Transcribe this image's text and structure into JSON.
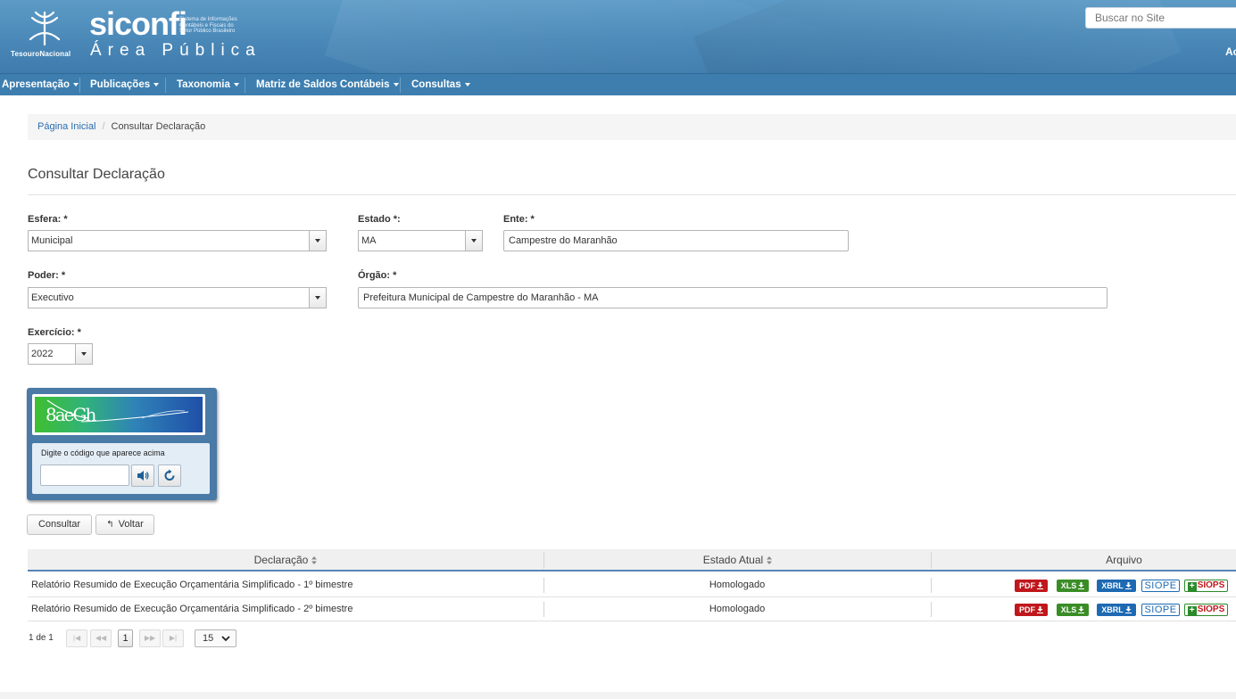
{
  "header": {
    "brand_left": "TesouroNacional",
    "brand": "siconfi",
    "brand_subtitle_1": "Sistema de Informações",
    "brand_subtitle_2": "Contábeis e Fiscais do",
    "brand_subtitle_3": "Setor Público Brasileiro",
    "area": "Área Pública",
    "search_placeholder": "Buscar no Site",
    "cut_text": "Ac"
  },
  "nav": {
    "items": [
      {
        "label": "Apresentação"
      },
      {
        "label": "Publicações"
      },
      {
        "label": "Taxonomia"
      },
      {
        "label": "Matriz de Saldos Contábeis"
      },
      {
        "label": "Consultas"
      }
    ]
  },
  "breadcrumb": {
    "home": "Página Inicial",
    "separator": "/",
    "current": "Consultar Declaração"
  },
  "page": {
    "title": "Consultar Declaração"
  },
  "form": {
    "esfera": {
      "label": "Esfera: *",
      "value": "Municipal"
    },
    "estado": {
      "label": "Estado *:",
      "value": "MA"
    },
    "ente": {
      "label": "Ente: *",
      "value": "Campestre do Maranhão"
    },
    "poder": {
      "label": "Poder: *",
      "value": "Executivo"
    },
    "orgao": {
      "label": "Órgão: *",
      "value": "Prefeitura Municipal de Campestre do Maranhão - MA"
    },
    "exercicio": {
      "label": "Exercício: *",
      "value": "2022"
    }
  },
  "captcha": {
    "code": "8aeGh",
    "hint": "Digite o código que aparece acima",
    "input_value": ""
  },
  "actions": {
    "consultar": "Consultar",
    "voltar": "Voltar"
  },
  "table": {
    "headers": {
      "declaracao": "Declaração",
      "estado": "Estado Atual",
      "arquivo": "Arquivo"
    },
    "rows": [
      {
        "declaracao": "Relatório Resumido de Execução Orçamentária Simplificado - 1º bimestre",
        "estado": "Homologado"
      },
      {
        "declaracao": "Relatório Resumido de Execução Orçamentária Simplificado - 2º bimestre",
        "estado": "Homologado"
      }
    ],
    "file_labels": {
      "pdf": "PDF",
      "xls": "XLS",
      "xbrl": "XBRL",
      "siope": "SIOPE",
      "siops": "SIOPS"
    },
    "colors": {
      "pdf": "#c0171c",
      "xls": "#3a8d26",
      "xbrl": "#1d6ab3"
    }
  },
  "pager": {
    "info": "1 de 1",
    "first": "|◀",
    "prev": "◀◀",
    "current": "1",
    "next": "▶▶",
    "last": "▶|",
    "page_size": "15"
  },
  "theme": {
    "header_blue": "#4a88b8",
    "nav_blue": "#3d7eaf",
    "link_blue": "#2a6db0"
  }
}
